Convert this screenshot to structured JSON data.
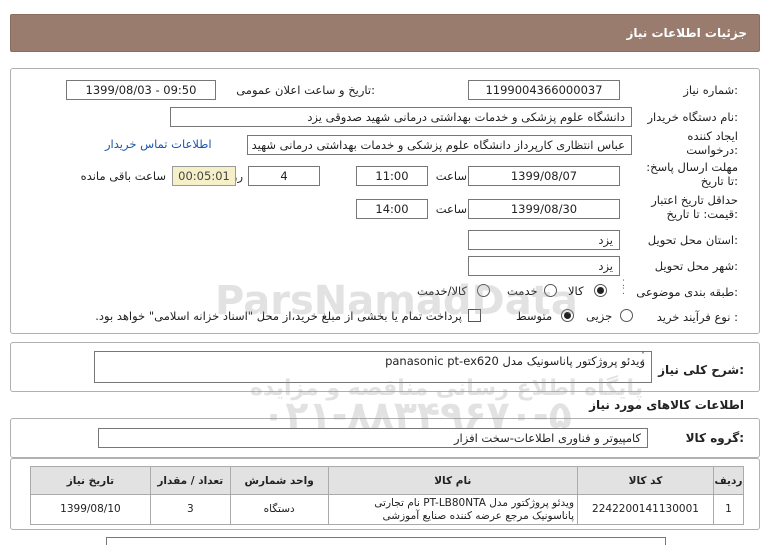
{
  "header": {
    "title": "جزئیات اطلاعات نیاز"
  },
  "fields": {
    "need_number_label": "شماره نیاز:",
    "need_number": "1199004366000037",
    "announce_label": "تاریخ و ساعت اعلان عمومی:",
    "announce_value": "1399/08/03 - 09:50",
    "buyer_org_label": "نام دستگاه خریدار:",
    "buyer_org": "دانشگاه علوم پزشکی و خدمات بهداشتی درمانی شهید صدوقی یزد",
    "creator_label": "ایجاد کننده درخواست:",
    "creator": "عباس انتظاری کارپرداز دانشگاه علوم پزشکی و خدمات بهداشتی درمانی شهید",
    "contact_link": "اطلاعات تماس خریدار",
    "reply_deadline_label": "مهلت ارسال پاسخ: تا تاریخ:",
    "reply_date": "1399/08/07",
    "time_label": "ساعت",
    "reply_time": "11:00",
    "days": "4",
    "days_label": "روز و",
    "remaining_time": "00:05:01",
    "remaining_label": "ساعت باقی مانده",
    "price_validity_label": "حداقل تاریخ اعتبار قیمت: تا تاریخ:",
    "validity_date": "1399/08/30",
    "validity_time": "14:00",
    "province_label": "استان محل تحویل:",
    "province": "یزد",
    "city_label": "شهر محل تحویل:",
    "city": "یزد",
    "category_label": "طبقه بندی موضوعی:",
    "category_options": [
      "کالا",
      "خدمت",
      "کالا/خدمت"
    ],
    "purchase_type_label": "نوع فرآیند خرید :",
    "purchase_options": [
      "جزیی",
      "متوسط"
    ],
    "purchase_note": "پرداخت تمام یا بخشی از مبلغ خرید،از محل \"اسناد خزانه اسلامی\" خواهد بود."
  },
  "description": {
    "label": "شرح کلی نیاز:",
    "text": "ویدئو پروژکتور پاناسونیک مدل panasonic pt-ex620"
  },
  "goods": {
    "section_title": "اطلاعات کالاهای مورد نیاز",
    "group_label": "گروه کالا:",
    "group_value": "کامپیوتر و فناوری اطلاعات-سخت افزار",
    "columns": [
      "ردیف",
      "کد کالا",
      "نام کالا",
      "واحد شمارش",
      "تعداد / مقدار",
      "تاریخ نیاز"
    ],
    "rows": [
      {
        "row": "1",
        "code": "2242200141130001",
        "name": "ویدئو پروژکتور مدل PT-LB80NTA نام تجارتی پاناسونیک مرجع عرضه کننده صنایع آموزشی",
        "unit": "دستگاه",
        "qty": "3",
        "date": "1399/08/10"
      }
    ]
  },
  "watermark": {
    "brand": "ParsNamadData",
    "line1": "پایگاه اطلاع رسانی مناقصه و مزایده",
    "phone": "۰۲۱-۸۸۳۴۹۶۷۰-۵"
  }
}
